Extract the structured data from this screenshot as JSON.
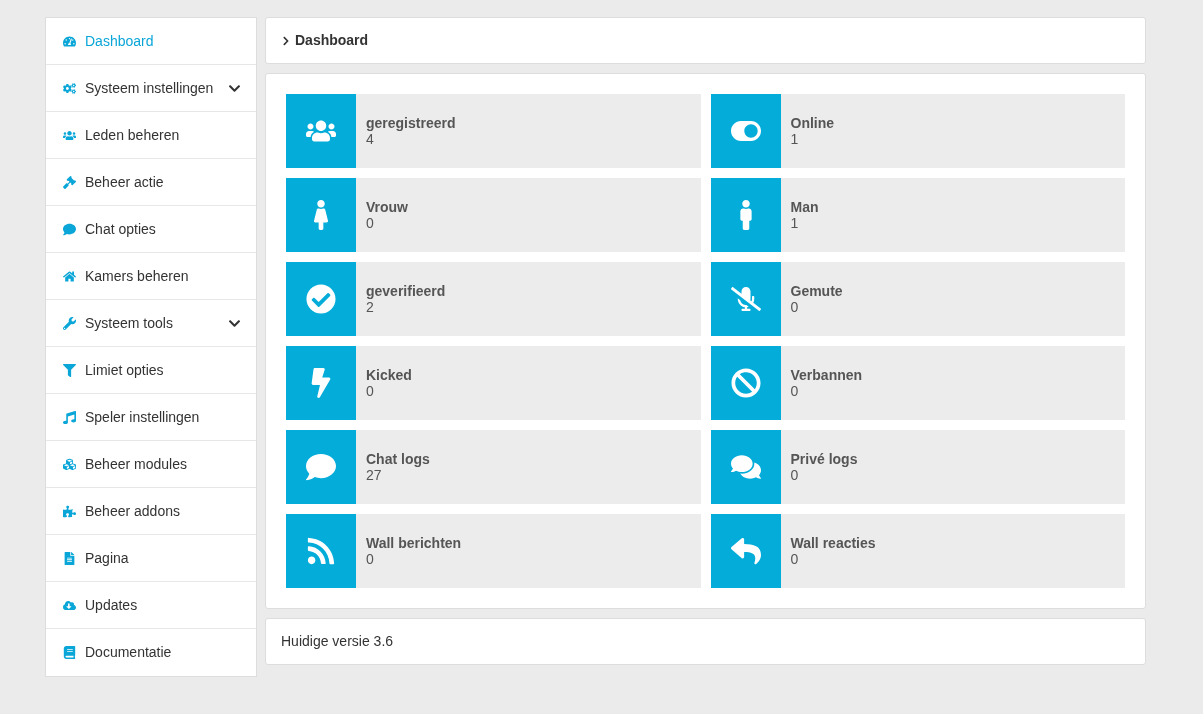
{
  "sidebar": {
    "items": [
      {
        "label": "Dashboard",
        "kind": "gauge",
        "selected": true,
        "submenu": false
      },
      {
        "label": "Systeem instellingen",
        "kind": "cogs",
        "selected": false,
        "submenu": true
      },
      {
        "label": "Leden beheren",
        "kind": "users",
        "selected": false,
        "submenu": false
      },
      {
        "label": "Beheer actie",
        "kind": "gavel",
        "selected": false,
        "submenu": false
      },
      {
        "label": "Chat opties",
        "kind": "comment",
        "selected": false,
        "submenu": false
      },
      {
        "label": "Kamers beheren",
        "kind": "home",
        "selected": false,
        "submenu": false
      },
      {
        "label": "Systeem tools",
        "kind": "wrench",
        "selected": false,
        "submenu": true
      },
      {
        "label": "Limiet opties",
        "kind": "filter",
        "selected": false,
        "submenu": false
      },
      {
        "label": "Speler instellingen",
        "kind": "music",
        "selected": false,
        "submenu": false
      },
      {
        "label": "Beheer modules",
        "kind": "cubes",
        "selected": false,
        "submenu": false
      },
      {
        "label": "Beheer addons",
        "kind": "puzzle",
        "selected": false,
        "submenu": false
      },
      {
        "label": "Pagina",
        "kind": "file",
        "selected": false,
        "submenu": false
      },
      {
        "label": "Updates",
        "kind": "cloud",
        "selected": false,
        "submenu": false
      },
      {
        "label": "Documentatie",
        "kind": "book",
        "selected": false,
        "submenu": false
      }
    ]
  },
  "breadcrumb": {
    "title": "Dashboard"
  },
  "stats": [
    {
      "label": "geregistreerd",
      "value": "4",
      "kind": "users"
    },
    {
      "label": "Online",
      "value": "1",
      "kind": "toggle"
    },
    {
      "label": "Vrouw",
      "value": "0",
      "kind": "female"
    },
    {
      "label": "Man",
      "value": "1",
      "kind": "male"
    },
    {
      "label": "geverifieerd",
      "value": "2",
      "kind": "check"
    },
    {
      "label": "Gemute",
      "value": "0",
      "kind": "mute"
    },
    {
      "label": "Kicked",
      "value": "0",
      "kind": "bolt"
    },
    {
      "label": "Verbannen",
      "value": "0",
      "kind": "ban"
    },
    {
      "label": "Chat logs",
      "value": "27",
      "kind": "comment"
    },
    {
      "label": "Privé logs",
      "value": "0",
      "kind": "comments"
    },
    {
      "label": "Wall berichten",
      "value": "0",
      "kind": "rss"
    },
    {
      "label": "Wall reacties",
      "value": "0",
      "kind": "reply"
    }
  ],
  "footer": {
    "version": "Huidige versie 3.6"
  }
}
